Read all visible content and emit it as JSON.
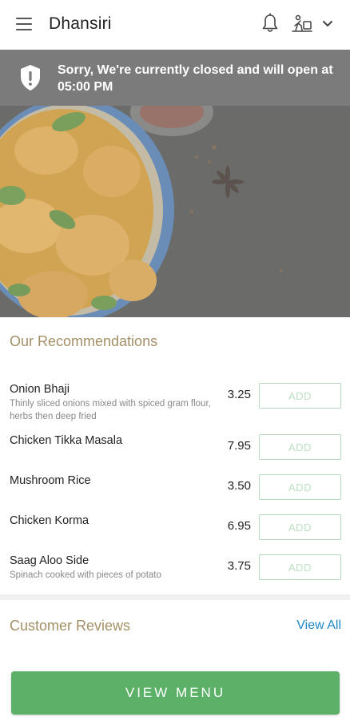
{
  "header": {
    "title": "Dhansiri",
    "menu_icon": "hamburger-menu-icon",
    "notification_icon": "bell-icon",
    "order_mode_icon": "pedestrian-delivery-icon",
    "dropdown_icon": "chevron-down-icon"
  },
  "closed_banner": {
    "icon": "shield-alert-icon",
    "message": "Sorry, We're currently closed and will open at 05:00 PM"
  },
  "hero": {
    "image": "food-curry-dish-photo"
  },
  "recommendations": {
    "heading": "Our Recommendations",
    "add_label": "ADD",
    "items": [
      {
        "name": "Onion Bhaji",
        "description": "Thinly sliced onions mixed with spiced gram flour, herbs then deep fried",
        "price": "3.25"
      },
      {
        "name": "Chicken Tikka Masala",
        "description": "",
        "price": "7.95"
      },
      {
        "name": "Mushroom Rice",
        "description": "",
        "price": "3.50"
      },
      {
        "name": "Chicken Korma",
        "description": "",
        "price": "6.95"
      },
      {
        "name": "Saag Aloo Side",
        "description": "Spinach cooked with pieces of potato",
        "price": "3.75"
      }
    ]
  },
  "reviews": {
    "heading": "Customer Reviews",
    "view_all_label": "View All"
  },
  "footer": {
    "button_label": "VIEW MENU"
  },
  "colors": {
    "banner_bg": "#7b7b7b",
    "section_heading": "#a39066",
    "link_blue": "#1e88c8",
    "primary_green": "#5cb068",
    "add_button_text": "#bde0c3"
  }
}
